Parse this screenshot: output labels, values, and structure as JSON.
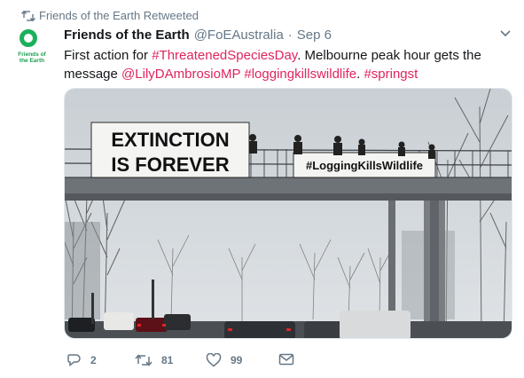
{
  "retweet_header": {
    "text": "Friends of the Earth Retweeted",
    "icon": "retweet-icon"
  },
  "avatar": {
    "logo_text_line1": "Friends of",
    "logo_text_line2": "the Earth"
  },
  "tweet": {
    "name": "Friends of the Earth",
    "handle": "@FoEAustralia",
    "separator": "·",
    "date": "Sep 6",
    "text_parts": {
      "p1": "First action for ",
      "hashtag1": "#ThreatenedSpeciesDay",
      "p2": ". Melbourne peak hour gets the message ",
      "mention": "@LilyDAmbrosioMP",
      "p3": " ",
      "hashtag2": "#loggingkillswildlife",
      "p4": ". ",
      "hashtag3": "#springst"
    }
  },
  "photo": {
    "banner1_line1": "EXTINCTION",
    "banner1_line2": "IS FOREVER",
    "banner2": "#LoggingKillsWildlife"
  },
  "actions": {
    "reply_count": "2",
    "retweet_count": "81",
    "like_count": "99"
  },
  "colors": {
    "link": "#1b95e0",
    "mention": "#e0245e",
    "secondary_text": "#657786",
    "logo_green": "#1db05c"
  }
}
